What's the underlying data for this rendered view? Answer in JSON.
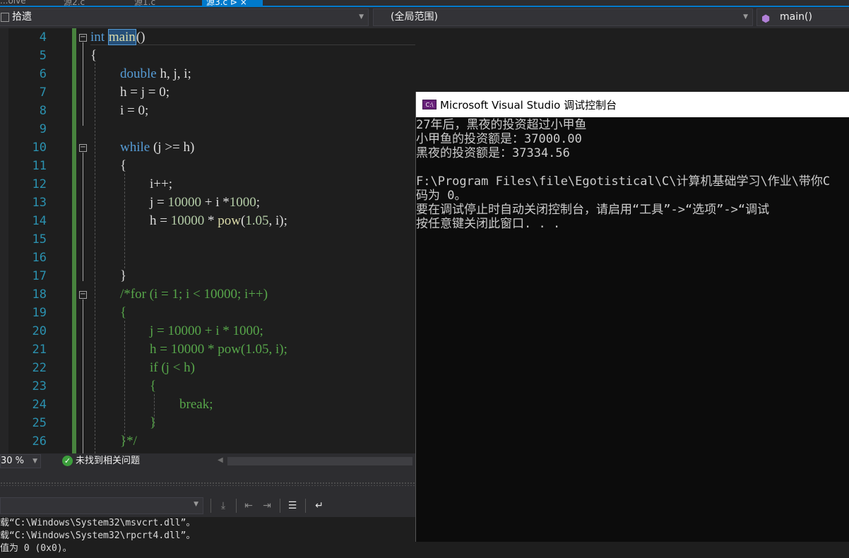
{
  "tabs": [
    {
      "label": "...olve",
      "active": false
    },
    {
      "label": "源2.c",
      "active": false
    },
    {
      "label": "源1.c",
      "active": false
    },
    {
      "label": "源3.c  ⊳ ×",
      "active": true
    }
  ],
  "nav": {
    "project": "拾遗",
    "scope": "(全局范围)",
    "member": "main()"
  },
  "editor": {
    "line_numbers": [
      "4",
      "5",
      "6",
      "7",
      "8",
      "9",
      "10",
      "11",
      "12",
      "13",
      "14",
      "15",
      "16",
      "17",
      "18",
      "19",
      "20",
      "21",
      "22",
      "23",
      "24",
      "25",
      "26"
    ],
    "code": {
      "l4_kw": "int",
      "l4_fn": "main",
      "l4_rest": "()",
      "l5": "{",
      "l6_kw": "double",
      "l6_rest": " h, j, i;",
      "l7": "h = j = 0;",
      "l8": "i = 0;",
      "l10_kw": "while",
      "l10_rest": " (j >= h)",
      "l11": "{",
      "l12": "i++;",
      "l13_a": "j = ",
      "l13_n1": "10000",
      "l13_b": " + i *",
      "l13_n2": "1000",
      "l13_c": ";",
      "l14_a": "h = ",
      "l14_n1": "10000",
      "l14_b": " * ",
      "l14_fn": "pow",
      "l14_c": "(",
      "l14_n2": "1.05",
      "l14_d": ", i);",
      "l17": "}",
      "l18": "/*for (i = 1; i < 10000; i++)",
      "l19": "{",
      "l20": "j = 10000 + i * 1000;",
      "l21": "h = 10000 * pow(1.05, i);",
      "l22": "if (j < h)",
      "l23": "{",
      "l24": "break;",
      "l25": "}",
      "l26": "}*/"
    }
  },
  "status": {
    "zoom": "30 %",
    "issues": "未找到相关问题"
  },
  "output": {
    "lines": [
      "载“C:\\Windows\\System32\\msvcrt.dll”。",
      "载“C:\\Windows\\System32\\rpcrt4.dll”。",
      "值为 0 (0x0)。"
    ]
  },
  "console": {
    "title": "Microsoft Visual Studio 调试控制台",
    "icon_label": "C:\\",
    "lines": [
      "27年后，黑夜的投资超过小甲鱼",
      "小甲鱼的投资额是：37000.00",
      "黑夜的投资额是：37334.56",
      "",
      "F:\\Program Files\\file\\Egotistical\\C\\计算机基础学习\\作业\\带你C",
      "码为 0。",
      "要在调试停止时自动关闭控制台，请启用“工具”->“选项”->“调试",
      "按任意键关闭此窗口. . ."
    ]
  },
  "colors": {
    "editor_bg": "#1e1e1e",
    "keyword": "#569cd6",
    "function": "#dcdcaa",
    "number": "#b5cea8",
    "comment": "#57a64a",
    "line_number": "#2b91af",
    "accent": "#007acc"
  }
}
